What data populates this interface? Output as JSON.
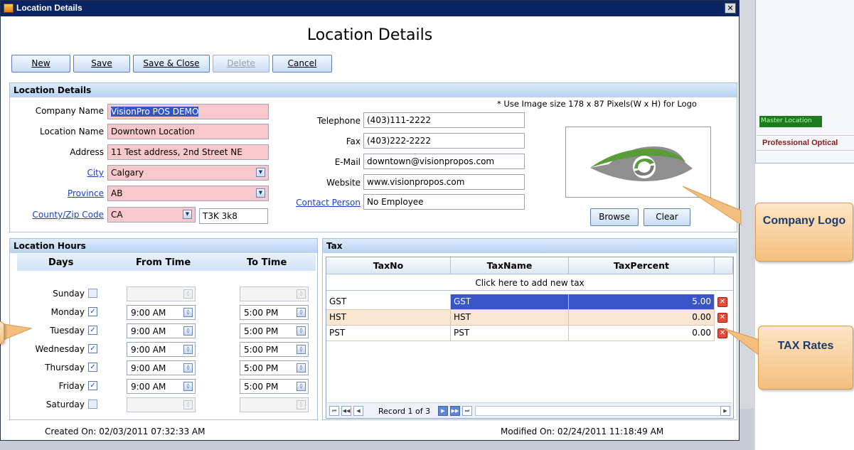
{
  "window": {
    "title": "Location Details",
    "heading": "Location Details"
  },
  "toolbar": {
    "new": "New",
    "save": "Save",
    "save_close": "Save & Close",
    "delete": "Delete",
    "cancel": "Cancel"
  },
  "location_details": {
    "header": "Location Details",
    "hint": "* Use Image size 178 x 87 Pixels(W x H) for Logo",
    "company_name_label": "Company Name",
    "company_name": "VisionPro POS DEMO",
    "location_name_label": "Location Name",
    "location_name": "Downtown Location",
    "address_label": "Address",
    "address": "11 Test address, 2nd Street NE",
    "city_label": "City",
    "city": "Calgary",
    "province_label": "Province",
    "province": "AB",
    "zip_label": "County/Zip Code",
    "country": "CA",
    "zip": "T3K 3k8",
    "telephone_label": "Telephone",
    "telephone": "(403)111-2222",
    "fax_label": "Fax",
    "fax": "(403)222-2222",
    "email_label": "E-Mail",
    "email": "downtown@visionpropos.com",
    "website_label": "Website",
    "website": "www.visionpropos.com",
    "contact_label": "Contact Person",
    "contact": "No Employee",
    "browse": "Browse",
    "clear": "Clear"
  },
  "hours": {
    "header": "Location Hours",
    "col_days": "Days",
    "col_from": "From Time",
    "col_to": "To Time",
    "days": [
      {
        "name": "Sunday",
        "checked": false,
        "from": "",
        "to": ""
      },
      {
        "name": "Monday",
        "checked": true,
        "from": "9:00 AM",
        "to": "5:00 PM"
      },
      {
        "name": "Tuesday",
        "checked": true,
        "from": "9:00 AM",
        "to": "5:00 PM"
      },
      {
        "name": "Wednesday",
        "checked": true,
        "from": "9:00 AM",
        "to": "5:00 PM"
      },
      {
        "name": "Thursday",
        "checked": true,
        "from": "9:00 AM",
        "to": "5:00 PM"
      },
      {
        "name": "Friday",
        "checked": true,
        "from": "9:00 AM",
        "to": "5:00 PM"
      },
      {
        "name": "Saturday",
        "checked": false,
        "from": "",
        "to": ""
      }
    ]
  },
  "tax": {
    "header": "Tax",
    "columns": [
      "TaxNo",
      "TaxName",
      "TaxPercent"
    ],
    "add_row": "Click here to add new tax",
    "rows": [
      {
        "no": "GST",
        "name": "GST",
        "percent": "5.00"
      },
      {
        "no": "HST",
        "name": "HST",
        "percent": "0.00"
      },
      {
        "no": "PST",
        "name": "PST",
        "percent": "0.00"
      }
    ],
    "pager": "Record 1 of 3"
  },
  "footer": {
    "created": "Created On:  02/03/2011 07:32:33 AM",
    "modified": "Modified On:  02/24/2011 11:18:49 AM"
  },
  "callouts": {
    "logo": "Company Logo",
    "tax": "TAX Rates"
  },
  "background_app": {
    "master_location": "Master Location",
    "professional_optical": "Professional Optical"
  },
  "colors": {
    "titlebar": "#0a2465",
    "required_field": "#f8c8cc",
    "selected_row": "#3a55c8",
    "callout": "#f4bf7e"
  }
}
